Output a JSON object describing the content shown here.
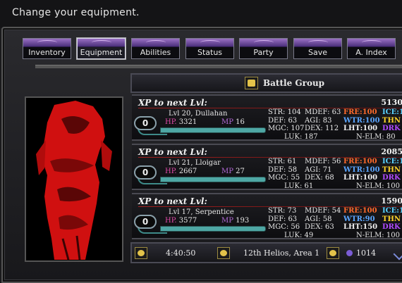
{
  "hint": "Change your equipment.",
  "tabs": [
    {
      "label": "Inventory"
    },
    {
      "label": "Equipment",
      "active": true
    },
    {
      "label": "Abilities"
    },
    {
      "label": "Status"
    },
    {
      "label": "Party"
    },
    {
      "label": "Save"
    },
    {
      "label": "A. Index"
    }
  ],
  "battle_group": {
    "title": "Battle Group"
  },
  "party": [
    {
      "xp_label": "XP to next Lvl:",
      "xp_value": "5130",
      "slot": "0",
      "name": "Lvl 20, Dullahan",
      "hp_label": "HP.",
      "hp": "3321",
      "mp_label": "MP",
      "mp": "16",
      "str": "STR: 104",
      "def": "DEF: 63",
      "mgc": "MGC: 107",
      "luk": "LUK: 187",
      "mdef": "MDEF: 63",
      "agi": "AGI: 83",
      "dex": "DEX: 112",
      "fre": "FRE:100",
      "wtr": "WTR:100",
      "lht": "LHT:100",
      "ice": "ICE:1",
      "thn": "THN",
      "drk": "DRK",
      "nelm": "N-ELM: 80"
    },
    {
      "xp_label": "XP to next Lvl:",
      "xp_value": "2085",
      "slot": "0",
      "name": "Lvl 21, Lloigar",
      "hp_label": "HP.",
      "hp": "2667",
      "mp_label": "MP",
      "mp": "27",
      "str": "STR: 61",
      "def": "DEF: 58",
      "mgc": "MGC: 55",
      "luk": "LUK: 61",
      "mdef": "MDEF: 56",
      "agi": "AGI: 71",
      "dex": "DEX: 68",
      "fre": "FRE:100",
      "wtr": "WTR:100",
      "lht": "LHT:100",
      "ice": "ICE:1",
      "thn": "THN",
      "drk": "DRK",
      "nelm": "N-ELM: 100"
    },
    {
      "xp_label": "XP to next Lvl:",
      "xp_value": "1590",
      "slot": "0",
      "name": "Lvl 17, Serpentice",
      "hp_label": "HP.",
      "hp": "3577",
      "mp_label": "MP",
      "mp": "193",
      "str": "STR: 73",
      "def": "DEF: 63",
      "mgc": "MGC: 56",
      "luk": "LUK: 49",
      "mdef": "MDEF: 54",
      "agi": "AGI: 58",
      "dex": "DEX: 63",
      "fre": "FRE:100",
      "wtr": "WTR:90",
      "lht": "LHT:150",
      "ice": "ICE:1",
      "thn": "THN",
      "drk": "DRK",
      "nelm": "N-ELM: 100"
    }
  ],
  "status_bar": {
    "time": "4:40:50",
    "location": "12th Helios, Area 1",
    "gold": "1014"
  },
  "colors": {
    "tab_accent": "#9a70c4",
    "hp_label": "#e04aa8",
    "mp_label": "#b36ad8",
    "bar": "#4ea7a4",
    "fire": "#ff6a2a",
    "water": "#5ba6ff",
    "ice": "#5ad2ff",
    "thunder": "#ffd42a",
    "dark": "#b04aff"
  },
  "icons": {
    "battle_group": "helmet-icon",
    "time": "clock-icon",
    "location": "compass-icon",
    "gold": "coin-icon",
    "portrait": "character-portrait"
  }
}
